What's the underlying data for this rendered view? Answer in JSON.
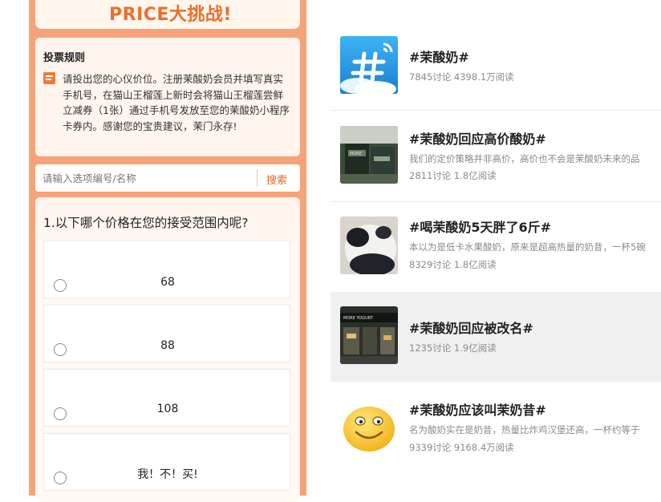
{
  "banner": {
    "title": "PRICE大挑战!"
  },
  "rules": {
    "title": "投票规则",
    "text": "请投出您的心仪价位。注册茉酸奶会员并填写真实手机号，在猫山王榴莲上新时会将猫山王榴莲尝鲜立减券（1张）通过手机号发放至您的茉酸奶小程序卡券内。感谢您的宝贵建议，茉门永存!"
  },
  "search": {
    "placeholder": "请输入选项编号/名称",
    "button_label": "搜索"
  },
  "question": {
    "title": "1.以下哪个价格在您的接受范围内呢?",
    "options": [
      {
        "label": "68"
      },
      {
        "label": "88"
      },
      {
        "label": "108"
      },
      {
        "label": "我！不！买!"
      }
    ]
  },
  "topics": [
    {
      "title": "#茉酸奶#",
      "desc": "",
      "stats": "7845讨论 4398.1万阅读",
      "thumb": "hashtag-icon"
    },
    {
      "title": "#茉酸奶回应高价酸奶#",
      "desc": "我们的定价策略并非高价，高价也不会是茉酸奶未来的品",
      "stats": "2811讨论 1.8亿阅读",
      "thumb": "store-photo"
    },
    {
      "title": "#喝茉酸奶5天胖了6斤#",
      "desc": "本以为是低卡水果酸奶，原来是超高热量的奶昔，一杯5碗",
      "stats": "8329讨论 1.8亿阅读",
      "thumb": "panda-photo"
    },
    {
      "title": "#茉酸奶回应被改名#",
      "desc": "",
      "stats": "1235讨论 1.9亿阅读",
      "thumb": "storefront-photo"
    },
    {
      "title": "#茉酸奶应该叫茉奶昔#",
      "desc": "名为酸奶实在是奶昔，热量比炸鸡汉堡还高，一杯约等于",
      "stats": "9339讨论 9168.4万阅读",
      "thumb": "smiley-emoji"
    }
  ],
  "colors": {
    "accent": "#ec6e2b",
    "panel": "#f6a37a",
    "highlight_row": "#f0f0f0"
  }
}
